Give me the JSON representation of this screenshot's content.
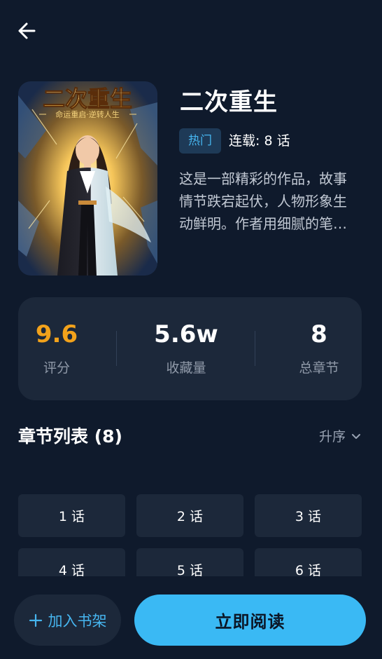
{
  "header": {
    "back_icon": "arrow-left-icon"
  },
  "book": {
    "title": "二次重生",
    "tag": "热门",
    "serial_status": "连载: 8 话",
    "description": "这是一部精彩的作品，故事情节跌宕起伏，人物形象生动鲜明。作者用细腻的笔触描绘了一个引人入胜的故事。",
    "cover": {
      "title_art": "二次重生",
      "subtitle_art": "命运重启·逆转人生"
    }
  },
  "stats": [
    {
      "value": "9.6",
      "label": "评分",
      "color": "#f2a21b"
    },
    {
      "value": "5.6w",
      "label": "收藏量",
      "color": "#ffffff"
    },
    {
      "value": "8",
      "label": "总章节",
      "color": "#ffffff"
    }
  ],
  "chapters": {
    "title": "章节列表 (8)",
    "sort_label": "升序",
    "sort_icon": "chevron-down-icon",
    "items": [
      "1 话",
      "2 话",
      "3 话",
      "4 话",
      "5 话",
      "6 话"
    ]
  },
  "actions": {
    "shelf_label": "加入书架",
    "shelf_icon": "plus-icon",
    "read_label": "立即阅读"
  },
  "colors": {
    "background": "#0f1a2c",
    "card": "#1c283a",
    "accent": "#3ab9f4",
    "rating": "#f2a21b"
  }
}
